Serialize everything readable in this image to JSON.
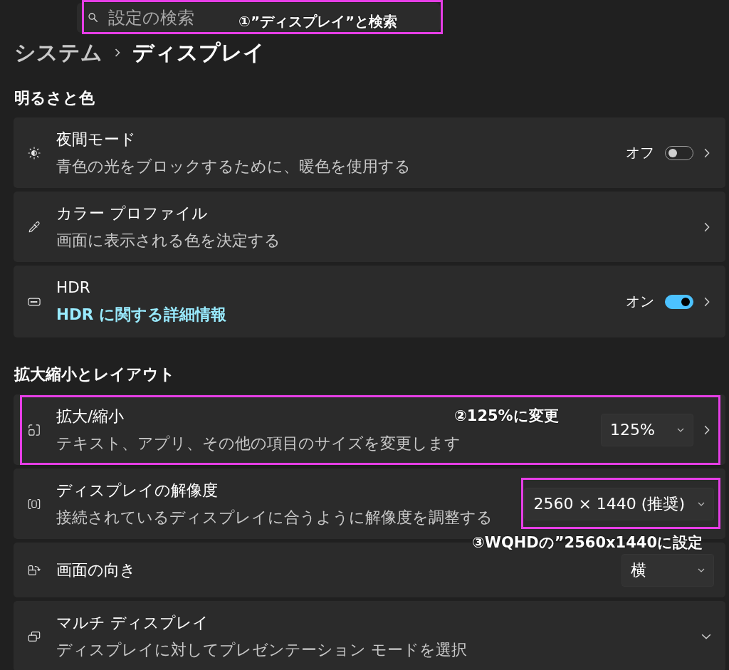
{
  "search": {
    "placeholder": "設定の検索",
    "highlighted": true,
    "note": "①”ディスプレイ”と検索"
  },
  "breadcrumb": [
    {
      "label": "システム",
      "current": false
    },
    {
      "label": "ディスプレイ",
      "current": true
    }
  ],
  "sections": [
    {
      "title": "明るさと色",
      "items": [
        {
          "kind": "nav",
          "title": "夜間モード",
          "description": "青色の光をブロックするために、暖色を使用する",
          "toggle": {
            "label": "オフ",
            "on": false
          },
          "highlighted": false
        },
        {
          "kind": "nav",
          "title": "カラー プロファイル",
          "description": "画面に表示される色を決定する",
          "highlighted": false
        },
        {
          "kind": "nav",
          "title": "HDR",
          "link": "HDR に関する詳細情報",
          "toggle": {
            "label": "オン",
            "on": true
          },
          "highlighted": false
        }
      ]
    },
    {
      "title": "拡大縮小とレイアウト",
      "items": [
        {
          "kind": "nav",
          "title": "拡大/縮小",
          "description": "テキスト、アプリ、その他の項目のサイズを変更します",
          "dropdown": {
            "value": "125%",
            "highlighted": false
          },
          "highlighted": true,
          "note": "②125%に変更"
        },
        {
          "kind": "plain",
          "title": "ディスプレイの解像度",
          "description": "接続されているディスプレイに合うように解像度を調整する",
          "dropdown": {
            "value": "2560 × 1440 (推奨)",
            "highlighted": true,
            "note": "③WQHDの”2560x1440に設定"
          },
          "highlighted": false
        },
        {
          "kind": "plain",
          "title": "画面の向き",
          "dropdown": {
            "value": "横",
            "highlighted": false
          },
          "highlighted": false
        },
        {
          "kind": "expander",
          "title": "マルチ ディスプレイ",
          "description": "ディスプレイに対してプレゼンテーション モードを選択",
          "expanded": false,
          "highlighted": false
        }
      ]
    }
  ]
}
